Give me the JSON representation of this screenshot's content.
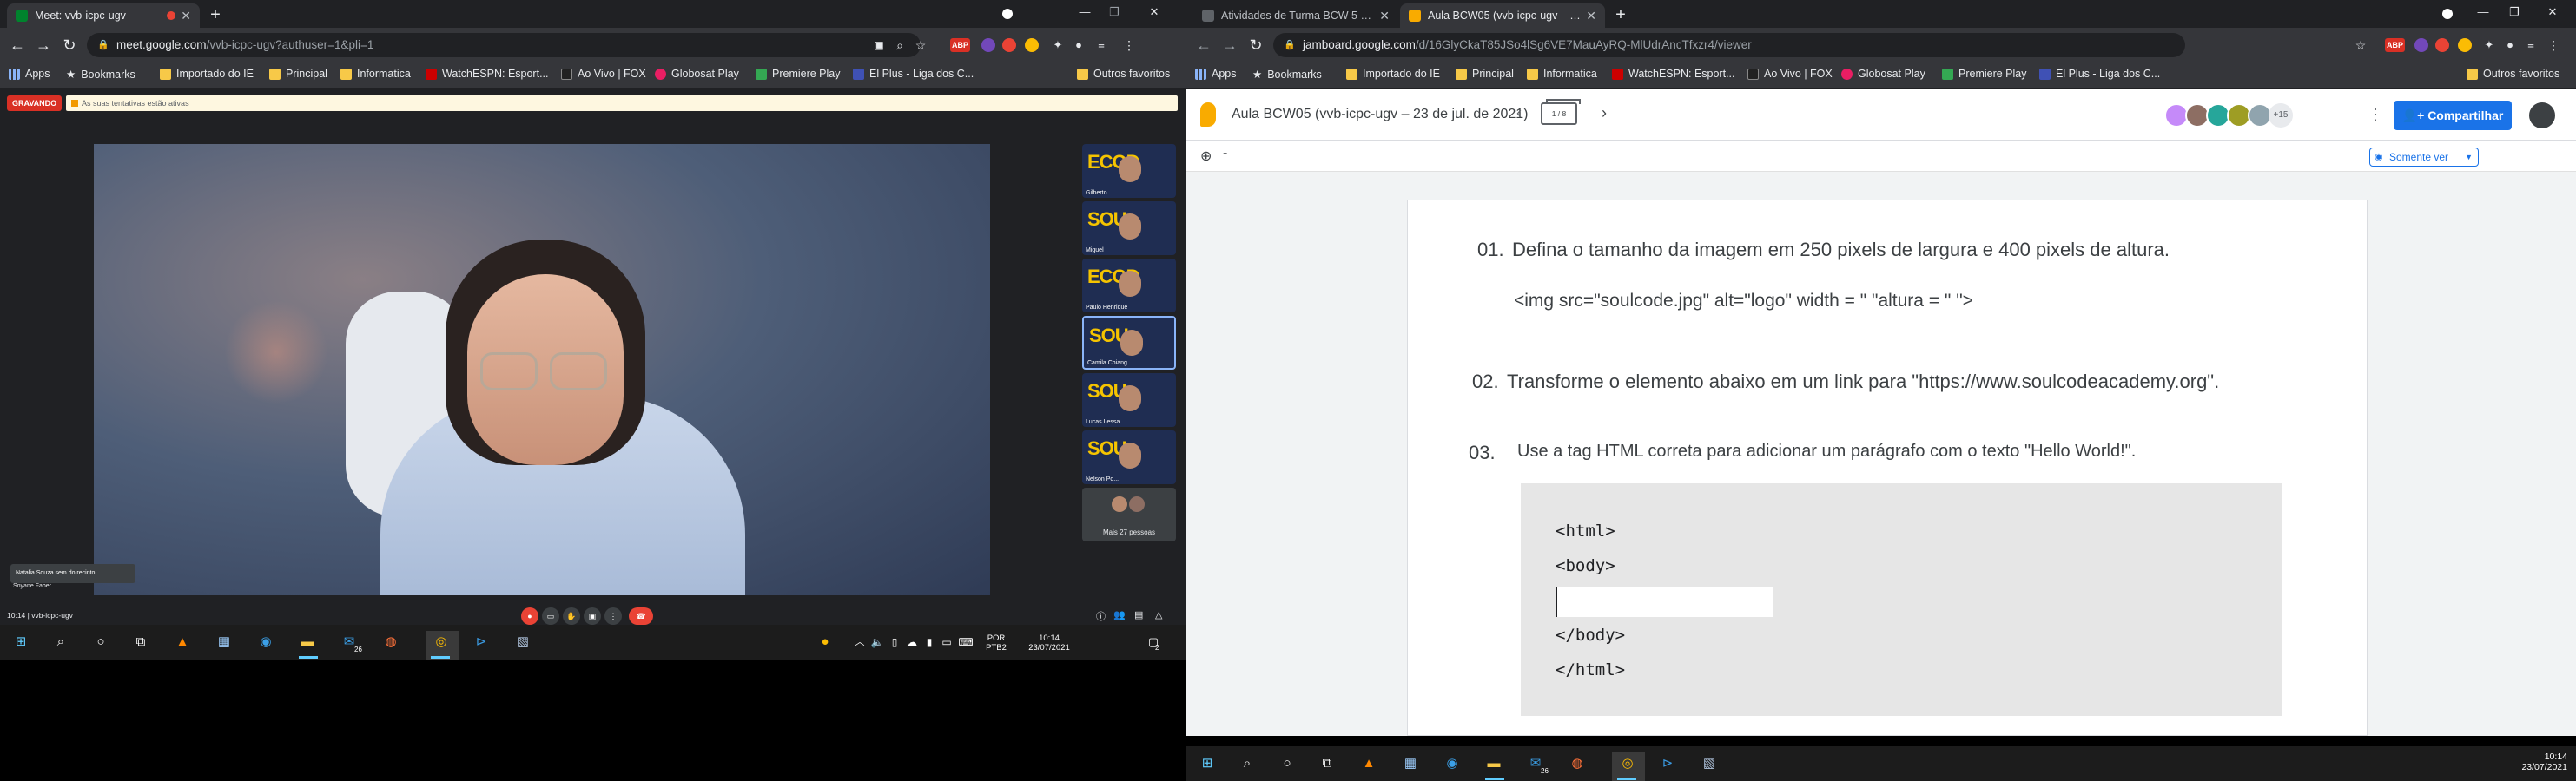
{
  "left_browser": {
    "tab_title": "Meet: vvb-icpc-ugv",
    "url_host": "meet.google.com",
    "url_path": "/vvb-icpc-ugv?authuser=1&pli=1",
    "bookmarks": [
      "Apps",
      "Bookmarks",
      "Importado do IE",
      "Principal",
      "Informatica",
      "WatchESPN: Esport...",
      "Ao Vivo | FOX",
      "Globosat Play",
      "Premiere Play",
      "El Plus - Liga dos C..."
    ],
    "bookmarks_other": "Outros favoritos"
  },
  "meet": {
    "recording_badge": "GRAVANDO",
    "info_text": "As suas tentativas estão ativas",
    "caption_text": "Natalia Souza sem do recinto",
    "speaker_name": "Soyane Faber",
    "tiles": [
      {
        "brand": "ECOD",
        "name": "Gilberto"
      },
      {
        "brand": "SOU",
        "name": "Miguel"
      },
      {
        "brand": "ECOD",
        "name": "Paulo Henrique"
      },
      {
        "brand": "SOU",
        "name": "Camila Chiang"
      },
      {
        "brand": "SOU",
        "name": "Lucas Lessa"
      },
      {
        "brand": "SOU",
        "name": "Nelson Po..."
      }
    ],
    "more_people": "Mais 27 pessoas",
    "meeting_time": "10:14",
    "meeting_code": "vvb-icpc-ugv"
  },
  "taskbar_left": {
    "lang_top": "POR",
    "lang_bottom": "PTB2",
    "time": "10:14",
    "date": "23/07/2021",
    "notif_badge": "2",
    "mail_badge": "26"
  },
  "right_browser": {
    "tabs": [
      {
        "title": "Atividades de Turma BCW 5 - So..."
      },
      {
        "title": "Aula BCW05 (vvb-icpc-ugv – 23 d..."
      }
    ],
    "url_host": "jamboard.google.com",
    "url_path": "/d/16GlyCkaT85JSo4lSg6VE7MauAyRQ-MlUdrAncTfxzr4/viewer",
    "bookmarks": [
      "Apps",
      "Bookmarks",
      "Importado do IE",
      "Principal",
      "Informatica",
      "WatchESPN: Esport...",
      "Ao Vivo | FOX",
      "Globosat Play",
      "Premiere Play",
      "El Plus - Liga dos C..."
    ],
    "bookmarks_other": "Outros favoritos"
  },
  "jamboard": {
    "title": "Aula BCW05 (vvb-icpc-ugv – 23 de jul. de 2021)",
    "frame_counter": "1 / 8",
    "extra_collaborators": "+15",
    "share_label": "Compartilhar",
    "view_mode": "Somente ver",
    "zoom_separator": "-",
    "q1_num": "01.",
    "q1_text": "Defina o tamanho da imagem em 250 pixels de largura e 400 pixels de altura.",
    "q1_code": "<img src=\"soulcode.jpg\" alt=\"logo\" width = \" \"altura = \" \">",
    "q2_num": "02.",
    "q2_text": "Transforme o elemento abaixo em um link para \"https://www.soulcodeacademy.org\".",
    "q3_num": "03.",
    "q3_text": "Use a tag HTML correta para adicionar um parágrafo com o texto \"Hello World!\".",
    "code_lines": [
      "<html>",
      "<body>",
      "</body>",
      "</html>"
    ]
  },
  "taskbar_right": {
    "time": "10:14",
    "date": "23/07/2021",
    "mail_badge": "26"
  },
  "colors": {
    "accent_blue": "#1a73e8",
    "chrome_dark": "#202124",
    "chrome_tab": "#35363a",
    "meet_bg": "#202124",
    "record_red": "#d93025",
    "jam_yellow": "#f9ab00"
  }
}
